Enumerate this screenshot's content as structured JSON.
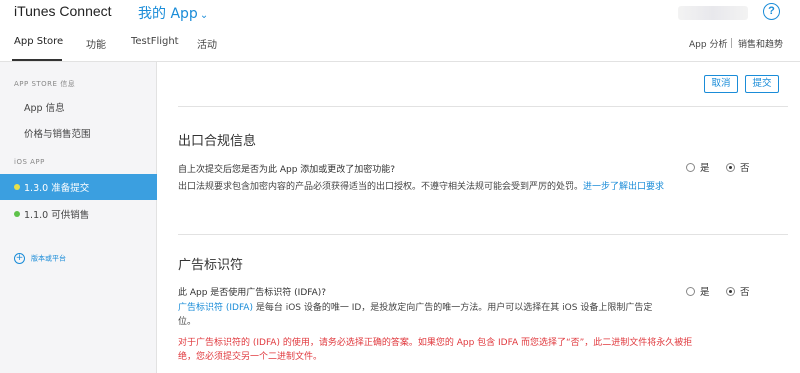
{
  "header": {
    "brand": "iTunes Connect",
    "app_menu": "我的 App",
    "help": "?"
  },
  "tabs": [
    {
      "label": "App Store",
      "active": true
    },
    {
      "label": "功能"
    },
    {
      "label": "TestFlight"
    },
    {
      "label": "活动"
    }
  ],
  "right_tabs": [
    "App 分析",
    "销售和趋势"
  ],
  "sidebar": {
    "section1_title": "APP STORE 信息",
    "items": [
      "App 信息",
      "价格与销售范围"
    ],
    "section2_title": "iOS APP",
    "versions": [
      {
        "label": "1.3.0 准备提交",
        "dot_color": "#e8e04a",
        "active": true
      },
      {
        "label": "1.1.0 可供销售",
        "dot_color": "#5ec24a",
        "active": false
      }
    ],
    "add_platform": "版本或平台"
  },
  "actions": {
    "cancel": "取消",
    "submit": "提交"
  },
  "export_compliance": {
    "title": "出口合规信息",
    "question": "自上次提交后您是否为此 App 添加或更改了加密功能?",
    "desc": "出口法规要求包含加密内容的产品必须获得适当的出口授权。不遵守相关法规可能会受到严厉的处罚。",
    "link": "进一步了解出口要求",
    "yes": "是",
    "no": "否",
    "selected": "否"
  },
  "idfa": {
    "title": "广告标识符",
    "question": "此 App 是否使用广告标识符 (IDFA)?",
    "link": "广告标识符 (IDFA)",
    "desc": " 是每台 iOS 设备的唯一 ID，是投放定向广告的唯一方法。用户可以选择在其 iOS 设备上限制广告定位。",
    "warning": "对于广告标识符的 (IDFA) 的使用，请务必选择正确的答案。如果您的 App 包含 IDFA 而您选择了“否”，此二进制文件将永久被拒绝，您必须提交另一个二进制文件。",
    "yes": "是",
    "no": "否",
    "selected": "否"
  },
  "colors": {
    "accent": "#1a8cd8",
    "active_row": "#3b9fe0",
    "warning": "#e0393e"
  }
}
